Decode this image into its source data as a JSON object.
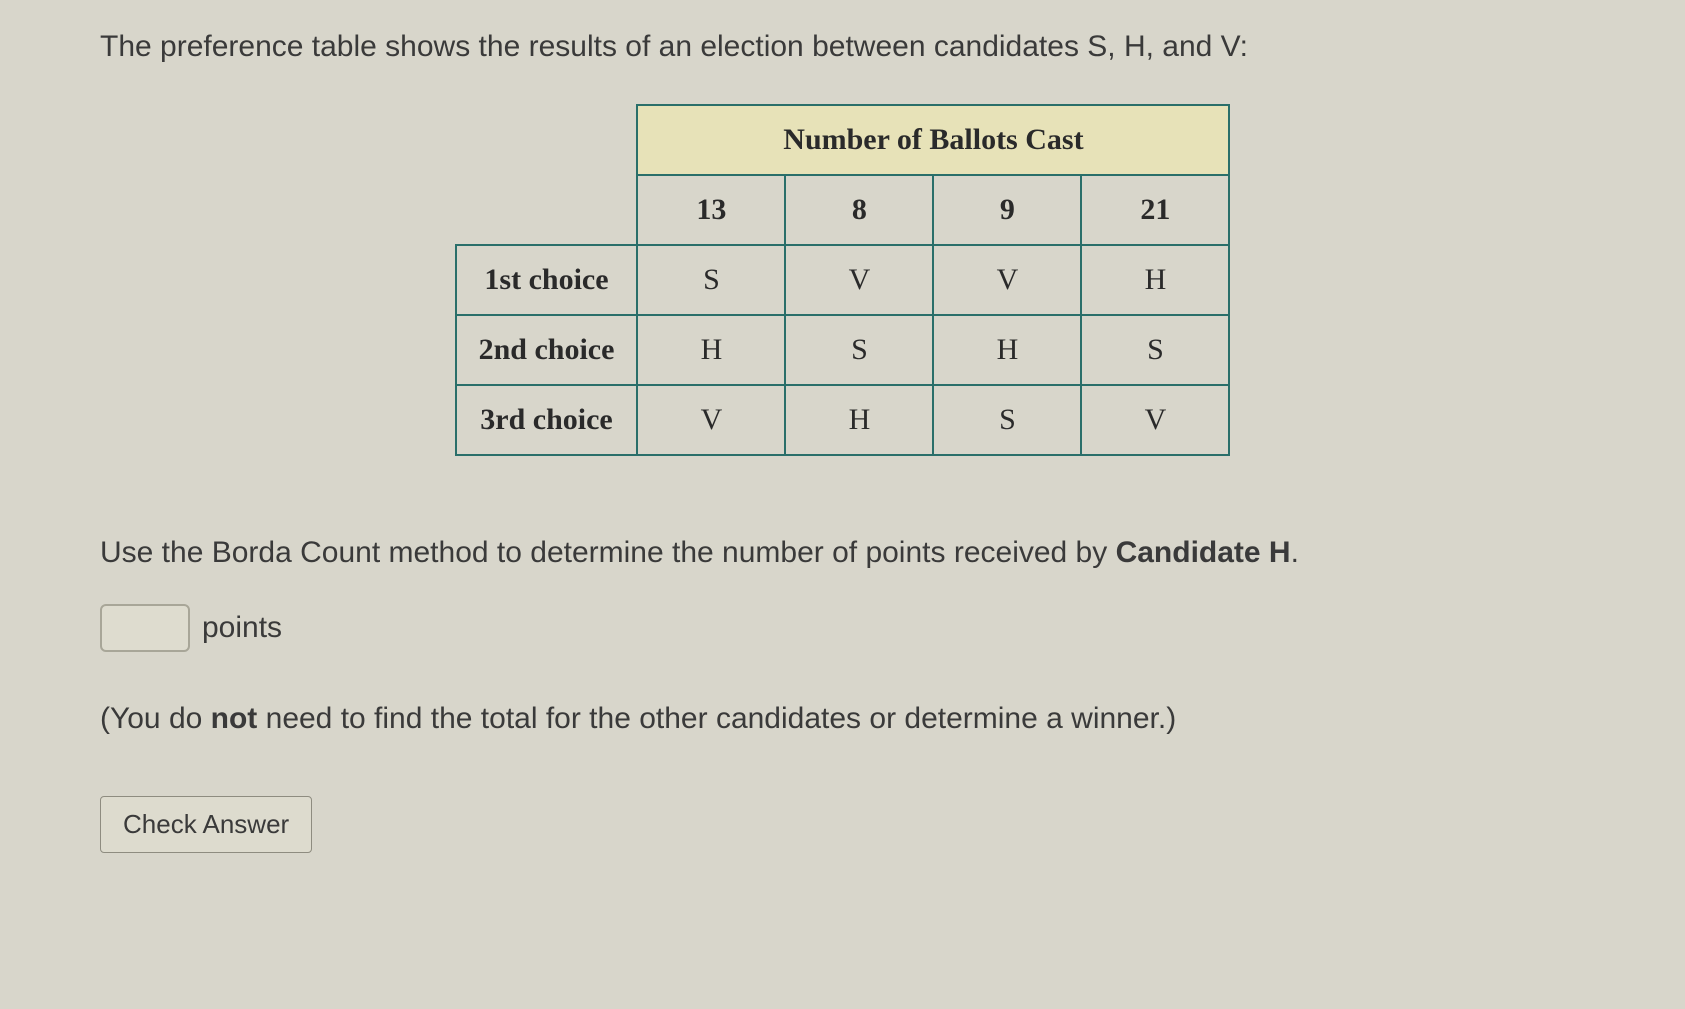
{
  "prompt": "The preference table shows the results of an election between candidates S, H, and V:",
  "table": {
    "header": "Number of Ballots Cast",
    "columns": [
      "13",
      "8",
      "9",
      "21"
    ],
    "rows": [
      {
        "label": "1st choice",
        "cells": [
          "S",
          "V",
          "V",
          "H"
        ]
      },
      {
        "label": "2nd choice",
        "cells": [
          "H",
          "S",
          "H",
          "S"
        ]
      },
      {
        "label": "3rd choice",
        "cells": [
          "V",
          "H",
          "S",
          "V"
        ]
      }
    ]
  },
  "instruction_prefix": "Use the Borda Count method to determine the number of points received by ",
  "instruction_bold": "Candidate H",
  "instruction_suffix": ".",
  "answer": {
    "value": "",
    "unit": "points"
  },
  "note_prefix": "(You do ",
  "note_bold": "not",
  "note_suffix": " need to find the total for the other candidates or determine a winner.)",
  "check_button": "Check Answer"
}
